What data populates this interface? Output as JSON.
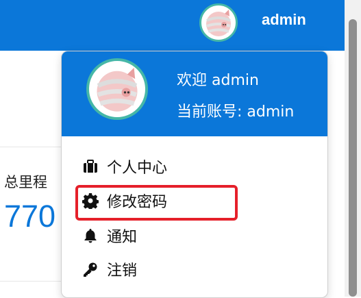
{
  "header": {
    "username": "admin"
  },
  "background": {
    "stat_label": "总里程",
    "stat_value": "770"
  },
  "dropdown": {
    "welcome": "欢迎 admin",
    "account": "当前账号: admin",
    "items": [
      {
        "label": "个人中心",
        "icon": "briefcase-icon"
      },
      {
        "label": "修改密码",
        "icon": "gear-icon"
      },
      {
        "label": "通知",
        "icon": "bell-icon"
      },
      {
        "label": "注销",
        "icon": "key-icon"
      }
    ]
  },
  "colors": {
    "primary": "#0b77d9",
    "highlight": "#e5202a",
    "avatar_ring": "#46b7a7"
  }
}
